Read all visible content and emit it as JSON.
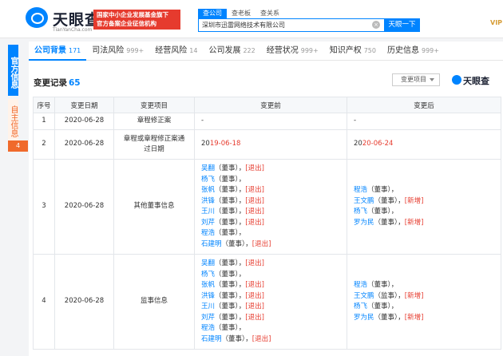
{
  "header": {
    "logo_text": "天眼查",
    "logo_subtext": "TianYanCha.com",
    "gov_badge_line1": "国家中小企业发展基金旗下",
    "gov_badge_line2": "官方备案企业征信机构",
    "search_tabs": [
      "查公司",
      "查老板",
      "查关系"
    ],
    "search_value": "深圳市迅雷网络技术有限公司",
    "search_button": "天眼一下",
    "vip": "VIP"
  },
  "side": {
    "tab_official": "官方信息",
    "tab_self": "自主信息",
    "self_count": "4"
  },
  "nav": [
    {
      "label": "公司背景",
      "count": "171"
    },
    {
      "label": "司法风险",
      "count": "999+"
    },
    {
      "label": "经营风险",
      "count": "14"
    },
    {
      "label": "公司发展",
      "count": "222"
    },
    {
      "label": "经营状况",
      "count": "999+"
    },
    {
      "label": "知识产权",
      "count": "750"
    },
    {
      "label": "历史信息",
      "count": "999+"
    }
  ],
  "section": {
    "title": "变更记录",
    "count": "65",
    "filter_label": "变更项目",
    "watermark": "天眼查"
  },
  "table": {
    "headers": [
      "序号",
      "变更日期",
      "变更项目",
      "变更前",
      "变更后"
    ],
    "rows": [
      {
        "index": "1",
        "date": "2020-06-28",
        "item": "章程修正案",
        "before": "-",
        "after": "-"
      },
      {
        "index": "2",
        "date": "2020-06-28",
        "item": "章程或章程修正案通过日期",
        "before_year": "20",
        "before_mid": "19-06-",
        "before_day": "18",
        "after_year": "20",
        "after_mid": "20-06-",
        "after_day": "24"
      },
      {
        "index": "3",
        "date": "2020-06-28",
        "item": "其他董事信息",
        "before": [
          {
            "name": "吴翻",
            "role": "（董事）",
            "tag": "[退出]"
          },
          {
            "name": "杨飞",
            "role": "（董事）",
            "tag": ""
          },
          {
            "name": "张帆",
            "role": "（董事）",
            "tag": "[退出]"
          },
          {
            "name": "洪锋",
            "role": "（董事）",
            "tag": "[退出]"
          },
          {
            "name": "王川",
            "role": "（董事）",
            "tag": "[退出]"
          },
          {
            "name": "刘芹",
            "role": "（董事）",
            "tag": "[退出]"
          },
          {
            "name": "程浩",
            "role": "（董事）",
            "tag": ""
          },
          {
            "name": "石建明",
            "role": "（董事）",
            "tag": "[退出]"
          }
        ],
        "after": [
          {
            "name": "程浩",
            "role": "（董事）",
            "tag": ""
          },
          {
            "name": "王文鹏",
            "role": "（董事）",
            "tag": "[新增]"
          },
          {
            "name": "杨飞",
            "role": "（董事）",
            "tag": ""
          },
          {
            "name": "罗为民",
            "role": "（董事）",
            "tag": "[新增]"
          }
        ]
      },
      {
        "index": "4",
        "date": "2020-06-28",
        "item": "监事信息",
        "before": [
          {
            "name": "吴翻",
            "role": "（董事）",
            "tag": "[退出]"
          },
          {
            "name": "杨飞",
            "role": "（董事）",
            "tag": ""
          },
          {
            "name": "张帆",
            "role": "（董事）",
            "tag": "[退出]"
          },
          {
            "name": "洪锋",
            "role": "（董事）",
            "tag": "[退出]"
          },
          {
            "name": "王川",
            "role": "（董事）",
            "tag": "[退出]"
          },
          {
            "name": "刘芹",
            "role": "（董事）",
            "tag": "[退出]"
          },
          {
            "name": "程浩",
            "role": "（董事）",
            "tag": ""
          },
          {
            "name": "石建明",
            "role": "（董事）",
            "tag": "[退出]"
          }
        ],
        "after": [
          {
            "name": "程浩",
            "role": "（董事）",
            "tag": ""
          },
          {
            "name": "王文鹏",
            "role": "（监事）",
            "tag": "[新增]"
          },
          {
            "name": "杨飞",
            "role": "（董事）",
            "tag": ""
          },
          {
            "name": "罗为民",
            "role": "（董事）",
            "tag": "[新增]"
          }
        ]
      }
    ]
  }
}
